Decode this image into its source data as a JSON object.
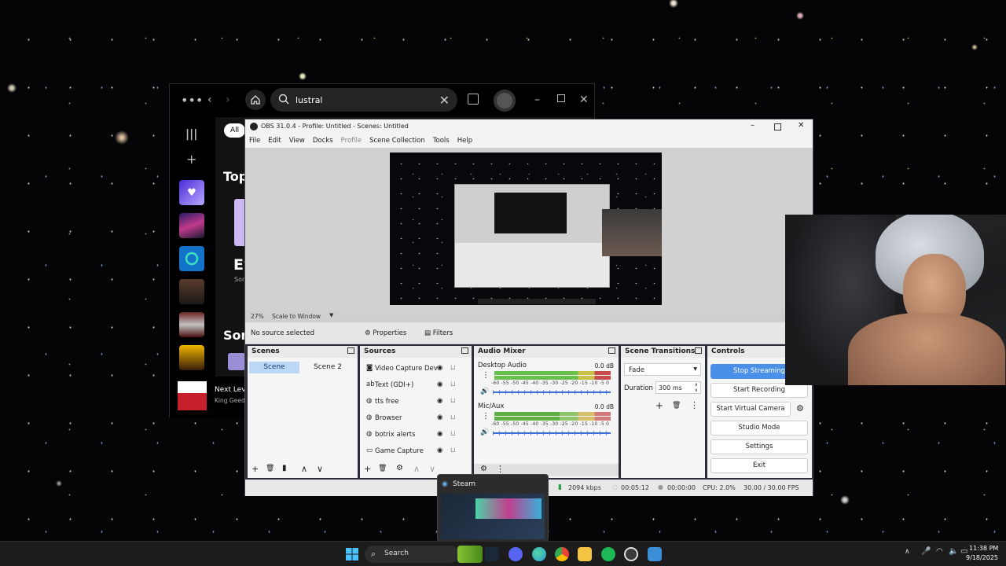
{
  "spotify": {
    "search_value": "lustral",
    "filter_all": "All",
    "section_top": "Top",
    "section_songs": "Son",
    "card_title": "Ev",
    "card_sub": "Son",
    "now_playing": {
      "title": "Next Lev",
      "artist": "King Geed"
    }
  },
  "obs": {
    "title": "OBS 31.0.4 - Profile: Untitled - Scenes: Untitled",
    "menu": [
      "File",
      "Edit",
      "View",
      "Docks",
      "Profile",
      "Scene Collection",
      "Tools",
      "Help"
    ],
    "zoom": "27%",
    "scale_mode": "Scale to Window",
    "no_source": "No source selected",
    "properties": "Properties",
    "filters": "Filters",
    "scenes": {
      "title": "Scenes",
      "items": [
        "Scene",
        "Scene 2"
      ]
    },
    "sources": {
      "title": "Sources",
      "items": [
        "Video Capture Dev",
        "Text (GDI+)",
        "tts free",
        "Browser",
        "botrix alerts",
        "Game Capture"
      ]
    },
    "mixer": {
      "title": "Audio Mixer",
      "channels": [
        {
          "name": "Desktop Audio",
          "db": "0.0 dB"
        },
        {
          "name": "Mic/Aux",
          "db": "0.0 dB"
        }
      ],
      "ticks": "-60 -55 -50 -45 -40 -35 -30 -25 -20 -15 -10 -5 0"
    },
    "transitions": {
      "title": "Scene Transitions",
      "type": "Fade",
      "duration_label": "Duration",
      "duration_value": "300 ms"
    },
    "controls": {
      "title": "Controls",
      "stop_streaming": "Stop Streaming",
      "start_recording": "Start Recording",
      "start_virtual_camera": "Start Virtual Camera",
      "studio_mode": "Studio Mode",
      "settings": "Settings",
      "exit": "Exit"
    },
    "status": {
      "bitrate": "2094 kbps",
      "stream_time": "00:05:12",
      "rec_time": "00:00:00",
      "cpu": "CPU: 2.0%",
      "fps": "30.00 / 30.00 FPS"
    }
  },
  "steam_preview": {
    "label": "Steam"
  },
  "taskbar": {
    "search": "Search",
    "time": "11:38 PM",
    "date": "9/18/2025",
    "colors": {
      "windows": "#4cc2ff",
      "discord": "#5865f2",
      "spotify": "#1db954",
      "edge": "#2b9bd6"
    }
  }
}
